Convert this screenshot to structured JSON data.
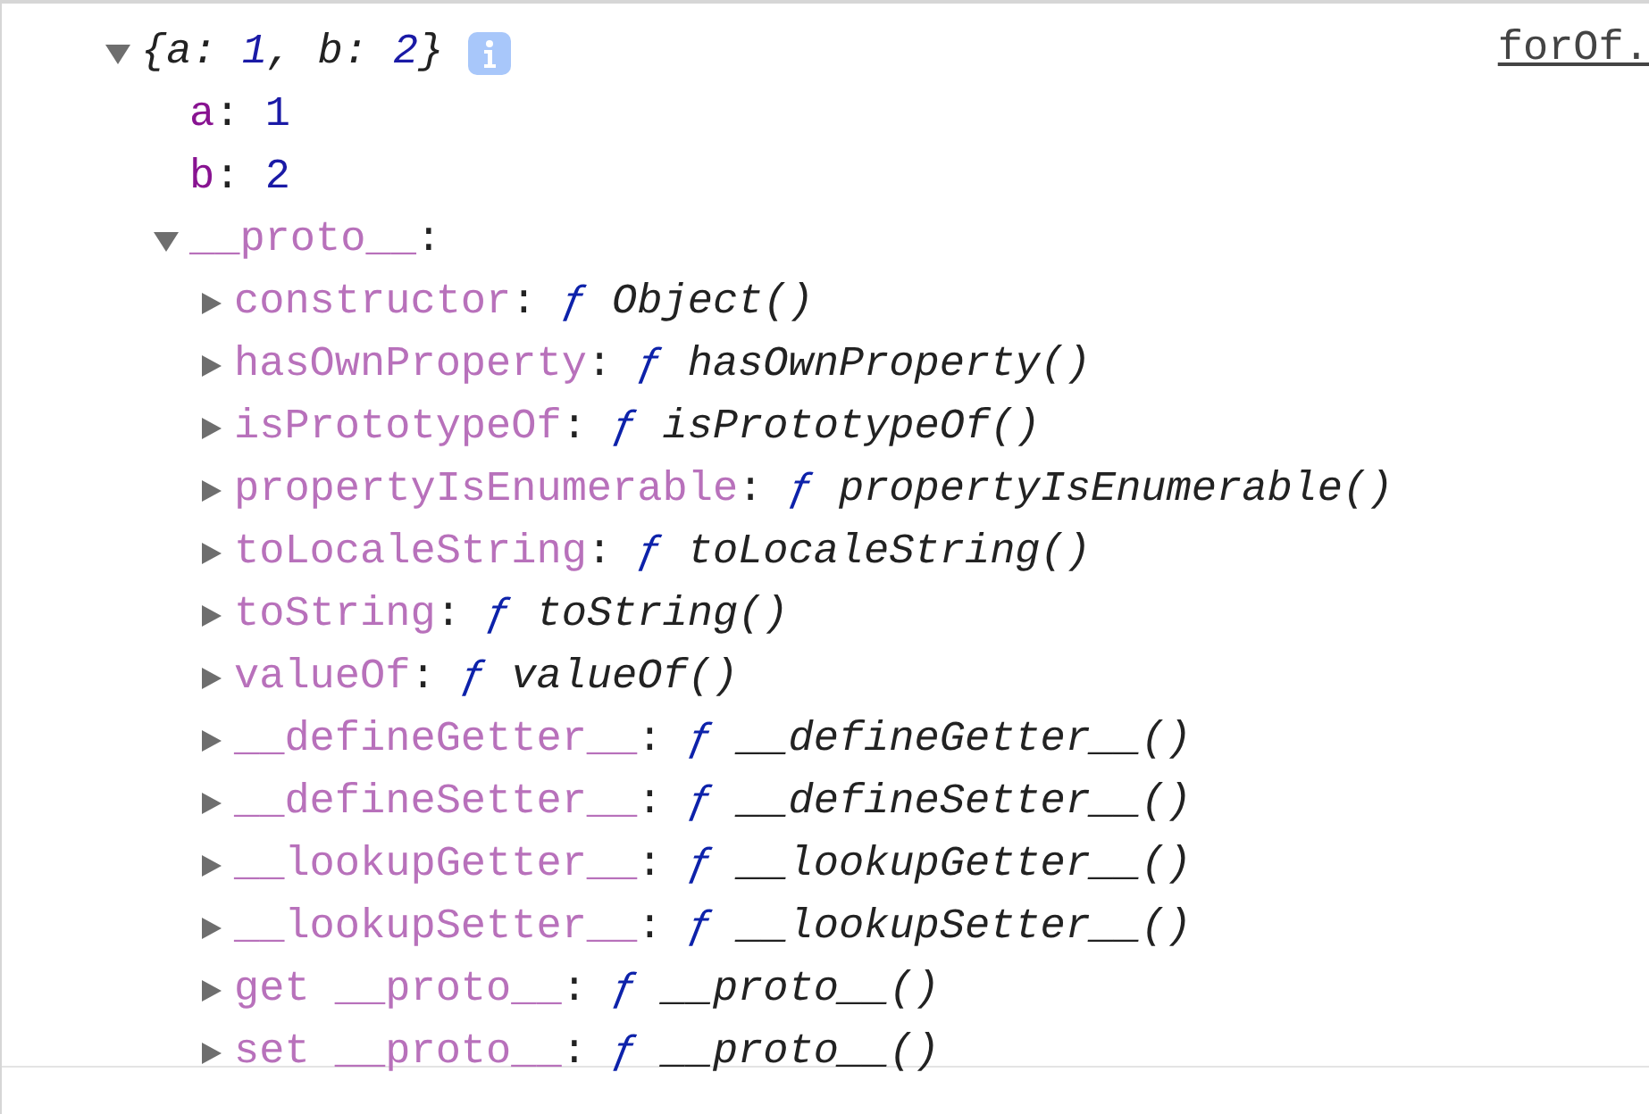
{
  "link": "forOf.",
  "object": {
    "expanded": true,
    "preview": [
      {
        "kind": "punct",
        "text": "{a: "
      },
      {
        "kind": "number",
        "text": "1"
      },
      {
        "kind": "punct",
        "text": ", b: "
      },
      {
        "kind": "number",
        "text": "2"
      },
      {
        "kind": "punct",
        "text": "}"
      }
    ],
    "children": [
      {
        "kind": "property",
        "key": "a",
        "separator": ":",
        "value": "1"
      },
      {
        "kind": "property",
        "key": "b",
        "separator": ":",
        "value": "2"
      },
      {
        "kind": "prototype",
        "key": "__proto__",
        "separator": ":",
        "expanded": true,
        "children": [
          {
            "kind": "function",
            "expanded": false,
            "key": "constructor",
            "separator": ":",
            "sigil": "ƒ",
            "value": "Object()"
          },
          {
            "kind": "function",
            "expanded": false,
            "key": "hasOwnProperty",
            "separator": ":",
            "sigil": "ƒ",
            "value": "hasOwnProperty()"
          },
          {
            "kind": "function",
            "expanded": false,
            "key": "isPrototypeOf",
            "separator": ":",
            "sigil": "ƒ",
            "value": "isPrototypeOf()"
          },
          {
            "kind": "function",
            "expanded": false,
            "key": "propertyIsEnumerable",
            "separator": ":",
            "sigil": "ƒ",
            "value": "propertyIsEnumerable()"
          },
          {
            "kind": "function",
            "expanded": false,
            "key": "toLocaleString",
            "separator": ":",
            "sigil": "ƒ",
            "value": "toLocaleString()"
          },
          {
            "kind": "function",
            "expanded": false,
            "key": "toString",
            "separator": ":",
            "sigil": "ƒ",
            "value": "toString()"
          },
          {
            "kind": "function",
            "expanded": false,
            "key": "valueOf",
            "separator": ":",
            "sigil": "ƒ",
            "value": "valueOf()"
          },
          {
            "kind": "function",
            "expanded": false,
            "key": "__defineGetter__",
            "separator": ":",
            "sigil": "ƒ",
            "value": "__defineGetter__()"
          },
          {
            "kind": "function",
            "expanded": false,
            "key": "__defineSetter__",
            "separator": ":",
            "sigil": "ƒ",
            "value": "__defineSetter__()"
          },
          {
            "kind": "function",
            "expanded": false,
            "key": "__lookupGetter__",
            "separator": ":",
            "sigil": "ƒ",
            "value": "__lookupGetter__()"
          },
          {
            "kind": "function",
            "expanded": false,
            "key": "__lookupSetter__",
            "separator": ":",
            "sigil": "ƒ",
            "value": "__lookupSetter__()"
          },
          {
            "kind": "function",
            "expanded": false,
            "key": "get __proto__",
            "separator": ":",
            "sigil": "ƒ",
            "value": "__proto__()"
          },
          {
            "kind": "function",
            "expanded": false,
            "key": "set __proto__",
            "separator": ":",
            "sigil": "ƒ",
            "value": "__proto__()"
          }
        ]
      }
    ]
  }
}
